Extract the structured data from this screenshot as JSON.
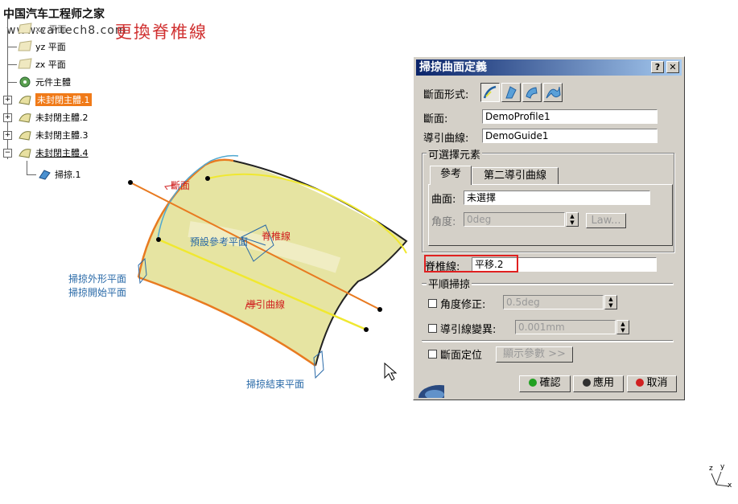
{
  "watermark": {
    "site_name": "中国汽车工程师之家",
    "site_url": "www.cartech8.com",
    "caption": "更換脊椎線"
  },
  "tree": {
    "items": [
      {
        "label": "xy 平面"
      },
      {
        "label": "yz 平面"
      },
      {
        "label": "zx 平面"
      },
      {
        "label": "元件主體"
      },
      {
        "label": "未封閉主體.1"
      },
      {
        "label": "未封閉主體.2"
      },
      {
        "label": "未封閉主體.3"
      },
      {
        "label": "未封閉主體.4"
      },
      {
        "label": "掃掠.1"
      }
    ]
  },
  "viewport": {
    "labels": {
      "section": "斷面",
      "spine": "脊椎線",
      "default_ref_plane": "預設參考平面",
      "sweep_profile_plane": "掃掠外形平面",
      "sweep_start_plane": "掃掠開始平面",
      "guide_curve": "導引曲線",
      "sweep_end_plane": "掃掠結束平面"
    },
    "compass": {
      "x": "x",
      "y": "y",
      "z": "z"
    }
  },
  "dialog": {
    "title": "掃掠曲面定義",
    "help_label": "?",
    "close_label": "✕",
    "profile_type_label": "斷面形式:",
    "section_label": "斷面:",
    "section_value": "DemoProfile1",
    "guide_label": "導引曲線:",
    "guide_value": "DemoGuide1",
    "optional_group": "可選擇元素",
    "tabs": [
      {
        "label": "參考"
      },
      {
        "label": "第二導引曲線"
      }
    ],
    "surface_label": "曲面:",
    "surface_value": "未選擇",
    "angle_label": "角度:",
    "angle_value": "0deg",
    "law_label": "Law...",
    "spine_label": "脊椎線:",
    "spine_value": "平移.2",
    "smooth_group": "平順掃掠",
    "angle_correction_label": "角度修正:",
    "angle_correction_value": "0.5deg",
    "deviation_label": "導引線變異:",
    "deviation_value": "0.001mm",
    "section_position_label": "斷面定位",
    "show_params_label": "顯示參數 >>",
    "ok_label": "確認",
    "apply_label": "應用",
    "cancel_label": "取消"
  },
  "colors": {
    "highlight": "#f07a18",
    "surface": "#e8e6a0",
    "edge": "#e87a20",
    "curve_yellow": "#f0e830",
    "label_blue": "#2a6aa8",
    "label_red": "#d02020",
    "spine_box": "#e02020",
    "title_bar": "#0a246a"
  }
}
